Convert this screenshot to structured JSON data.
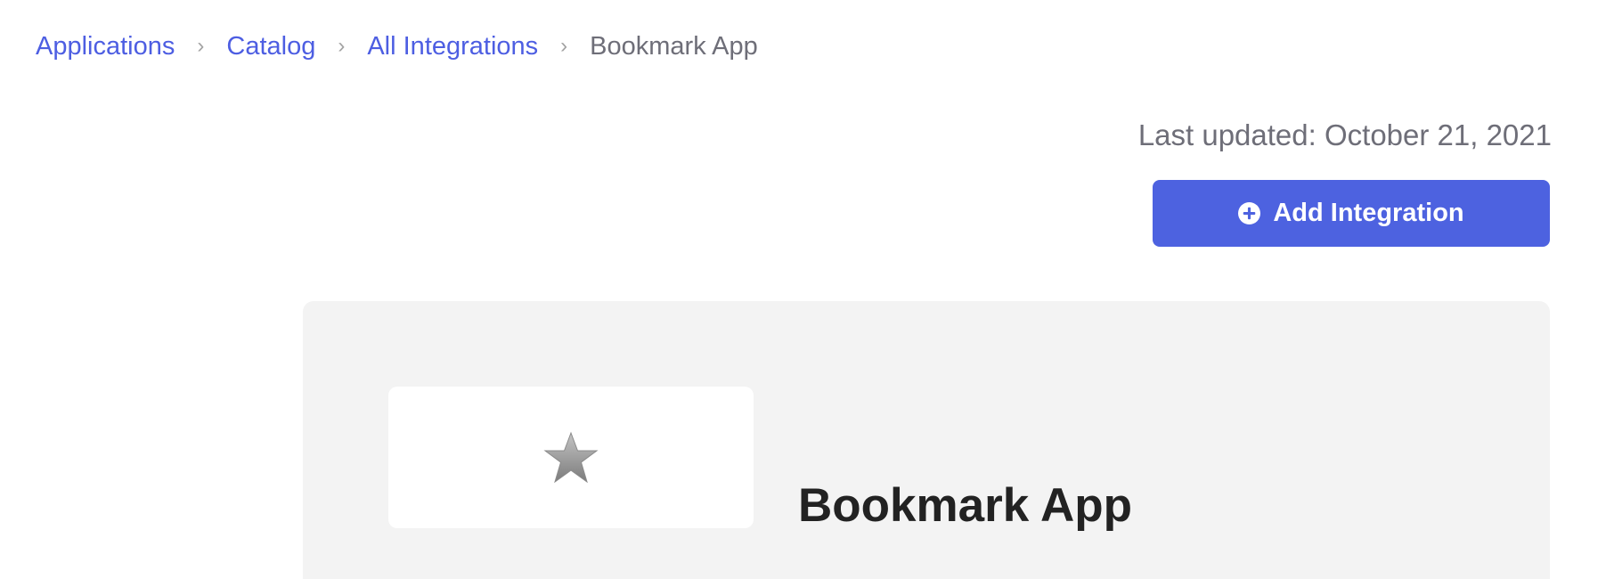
{
  "breadcrumb": {
    "items": [
      {
        "label": "Applications"
      },
      {
        "label": "Catalog"
      },
      {
        "label": "All Integrations"
      }
    ],
    "separator": "›",
    "current": "Bookmark App"
  },
  "header": {
    "last_updated": "Last updated: October 21, 2021",
    "add_button_label": "Add Integration",
    "add_button_icon": "plus-circle-icon"
  },
  "app": {
    "name": "Bookmark App",
    "logo_icon": "star-icon"
  },
  "colors": {
    "accent": "#4d62e0",
    "link": "#4d5ee2",
    "panel_bg": "#f3f3f3",
    "muted_text": "#6e6e78",
    "title_text": "#222222"
  }
}
